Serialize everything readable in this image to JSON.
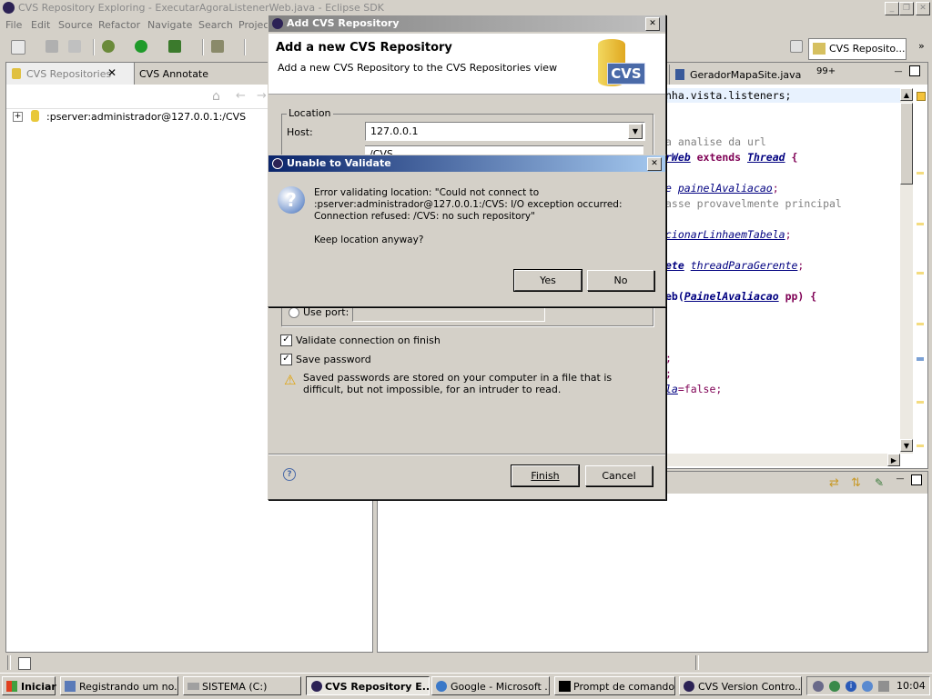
{
  "window": {
    "title": "CVS Repository Exploring - ExecutarAgoraListenerWeb.java - Eclipse SDK"
  },
  "menu": [
    "File",
    "Edit",
    "Source",
    "Refactor",
    "Navigate",
    "Search",
    "Projec"
  ],
  "perspective": {
    "label": "CVS Reposito..."
  },
  "left_view": {
    "tabs": [
      "CVS Repositories",
      "CVS Annotate"
    ],
    "tree_item": ":pserver:administrador@127.0.0.1:/CVS"
  },
  "editor": {
    "tabs": [
      "GeradorMapaSite.java",
      "99+"
    ],
    "lines": [
      {
        "parts": [
          {
            "t": "nha.vista.listeners;",
            "c": "plain"
          }
        ]
      },
      {
        "parts": [
          {
            "t": "a analise da url",
            "c": "comment"
          }
        ]
      },
      {
        "parts": [
          {
            "t": "rWeb",
            "c": "type"
          },
          {
            "t": " extends ",
            "c": "kw"
          },
          {
            "t": "Thread",
            "c": "type"
          },
          {
            "t": " {",
            "c": "plain"
          }
        ]
      },
      {
        "parts": [
          {
            "t": "e ",
            "c": "type"
          },
          {
            "t": "painelAvaliacao",
            "c": "field"
          },
          {
            "t": ";",
            "c": "plain"
          }
        ]
      },
      {
        "parts": [
          {
            "t": "asse provavelmente principal",
            "c": "comment"
          }
        ]
      },
      {
        "parts": [
          {
            "t": "cionarLinhaemTabela",
            "c": "field"
          },
          {
            "t": ";",
            "c": "plain"
          }
        ]
      },
      {
        "parts": [
          {
            "t": "ete",
            "c": "type"
          },
          {
            "t": " ",
            "c": "plain"
          },
          {
            "t": "threadParaGerente",
            "c": "field"
          },
          {
            "t": ";",
            "c": "plain"
          }
        ]
      },
      {
        "parts": [
          {
            "t": "eb(",
            "c": "plain"
          },
          {
            "t": "PainelAvaliacao",
            "c": "type"
          },
          {
            "t": " pp) {",
            "c": "plain"
          }
        ]
      },
      {
        "parts": [
          {
            "t": ";",
            "c": "plain"
          }
        ]
      },
      {
        "parts": [
          {
            "t": ";",
            "c": "plain"
          }
        ]
      },
      {
        "parts": [
          {
            "t": "la",
            "c": "field"
          },
          {
            "t": "=false;",
            "c": "plain"
          }
        ]
      }
    ]
  },
  "add_dialog": {
    "title": "Add CVS Repository",
    "heading": "Add a new CVS Repository",
    "description": "Add a new CVS Repository to the CVS Repositories view",
    "logo_text": "CVS",
    "location_group": "Location",
    "host_label": "Host:",
    "host_value": "127.0.0.1",
    "path_partial": "/CVS",
    "use_port_label": "Use port:",
    "validate_label": "Validate connection on finish",
    "save_password_label": "Save password",
    "warning_text": "Saved passwords are stored on your computer in a file that is difficult, but not impossible, for an intruder to read.",
    "finish": "Finish",
    "cancel": "Cancel"
  },
  "error_dialog": {
    "title": "Unable to Validate",
    "message": "Error validating location: \"Could not connect to :pserver:administrador@127.0.0.1:/CVS: I/O exception occurred: Connection refused: /CVS: no such repository\"",
    "question": "Keep location anyway?",
    "yes": "Yes",
    "no": "No"
  },
  "taskbar": {
    "start": "Iniciar",
    "buttons": [
      "Registrando um no...",
      "SISTEMA (C:)",
      "CVS Repository E...",
      "Google - Microsoft ...",
      "Prompt de comando",
      "CVS Version Contro..."
    ],
    "clock": "10:04"
  },
  "colors": {
    "title_active": "#0a246a",
    "title_active2": "#a6caf0",
    "keyword": "#7f0055",
    "field": "#0000c0",
    "comment": "#3f7f5f"
  }
}
